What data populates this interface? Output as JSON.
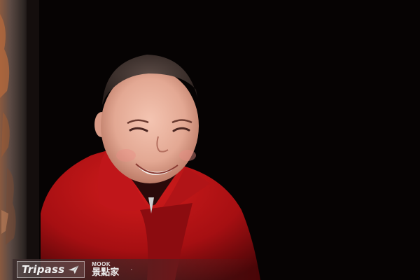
{
  "watermark": {
    "brand": "Tripass",
    "mook_label": "MOOK",
    "mook_chinese": "景點家",
    "dot": "·",
    "brand_icon": "plane-icon"
  },
  "colors": {
    "background": "#060303",
    "robe_red": "#b01214",
    "skin": "#e8b3a0",
    "door_frame": "#4a3c36"
  }
}
